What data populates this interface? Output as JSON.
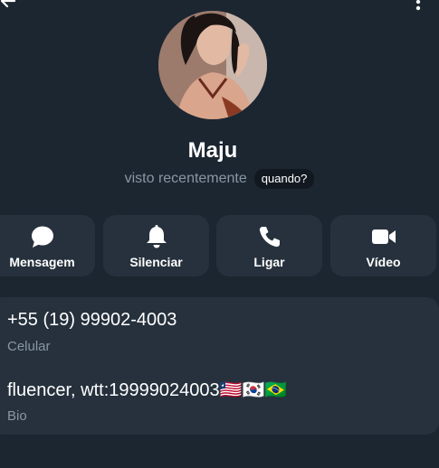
{
  "profile": {
    "name": "Maju",
    "last_seen": "visto recentemente",
    "when_badge": "quando?"
  },
  "actions": [
    {
      "label": "Mensagem",
      "icon": "chat-bubble-icon"
    },
    {
      "label": "Silenciar",
      "icon": "bell-icon"
    },
    {
      "label": "Ligar",
      "icon": "phone-icon"
    },
    {
      "label": "Vídeo",
      "icon": "video-camera-icon"
    }
  ],
  "info": {
    "phone": "+55 (19) 99902-4003",
    "phone_label": "Celular",
    "bio": "fluencer, wtt:19999024003🇱🇷🇰🇷🇧🇷",
    "bio_label": "Bio"
  },
  "colors": {
    "background": "#1c2631",
    "card": "#26313d",
    "muted_text": "#8a96a3"
  }
}
